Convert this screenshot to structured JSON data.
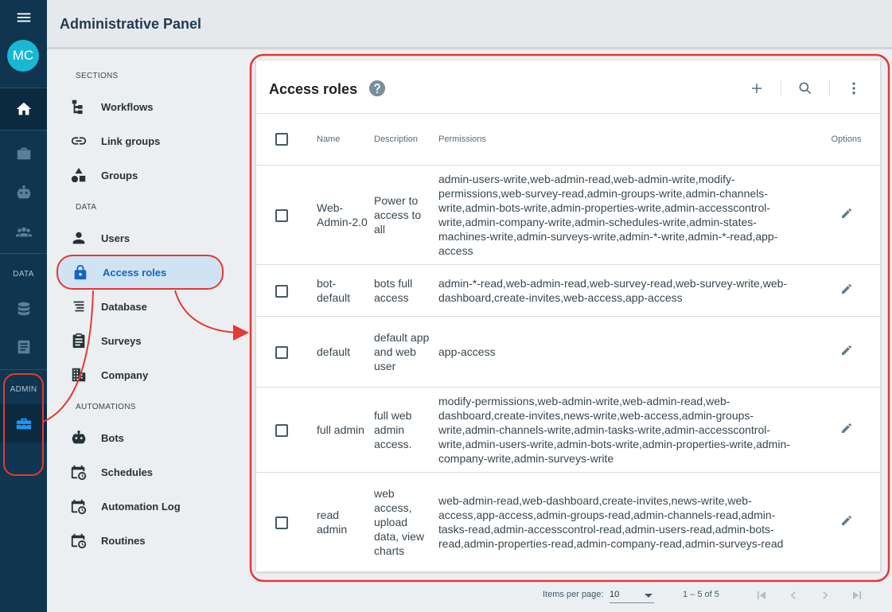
{
  "header": {
    "title": "Administrative Panel"
  },
  "rail": {
    "avatar_initials": "MC",
    "data_label": "DATA",
    "admin_label": "ADMIN",
    "icons": [
      "menu-icon",
      "home-icon",
      "briefcase-icon",
      "robot-icon",
      "people-icon",
      "database-icon",
      "document-icon",
      "toolbox-icon"
    ]
  },
  "nav": {
    "sections_label": "SECTIONS",
    "data_label": "DATA",
    "automations_label": "AUTOMATIONS",
    "items": [
      {
        "label": "Workflows",
        "icon": "sitemap-icon"
      },
      {
        "label": "Link groups",
        "icon": "link-icon"
      },
      {
        "label": "Groups",
        "icon": "shapes-icon"
      },
      {
        "label": "Users",
        "icon": "person-icon"
      },
      {
        "label": "Access roles",
        "icon": "lock-icon",
        "active": true
      },
      {
        "label": "Database",
        "icon": "sort-lines-icon"
      },
      {
        "label": "Surveys",
        "icon": "clipboard-icon"
      },
      {
        "label": "Company",
        "icon": "building-icon"
      },
      {
        "label": "Bots",
        "icon": "robot-icon"
      },
      {
        "label": "Schedules",
        "icon": "calendar-clock-icon"
      },
      {
        "label": "Automation Log",
        "icon": "calendar-clock-icon"
      },
      {
        "label": "Routines",
        "icon": "calendar-clock-icon"
      }
    ]
  },
  "card": {
    "title": "Access roles",
    "columns": {
      "name": "Name",
      "description": "Description",
      "permissions": "Permissions",
      "options": "Options"
    },
    "rows": [
      {
        "name": "Web-Admin-2.0",
        "description": "Power to access to all",
        "permissions": "admin-users-write,web-admin-read,web-admin-write,modify-permissions,web-survey-read,admin-groups-write,admin-channels-write,admin-bots-write,admin-properties-write,admin-accesscontrol-write,admin-company-write,admin-schedules-write,admin-states-machines-write,admin-surveys-write,admin-*-write,admin-*-read,app-access"
      },
      {
        "name": "bot-default",
        "description": "bots full access",
        "permissions": "admin-*-read,web-admin-read,web-survey-read,web-survey-write,web-dashboard,create-invites,web-access,app-access"
      },
      {
        "name": "default",
        "description": "default app and web user",
        "permissions": "app-access"
      },
      {
        "name": "full admin",
        "description": "full web admin access.",
        "permissions": "modify-permissions,web-admin-write,web-admin-read,web-dashboard,create-invites,news-write,web-access,admin-groups-write,admin-channels-write,admin-tasks-write,admin-accesscontrol-write,admin-users-write,admin-bots-write,admin-properties-write,admin-company-write,admin-surveys-write"
      },
      {
        "name": "read admin",
        "description": "web access, upload data, view charts",
        "permissions": "web-admin-read,web-dashboard,create-invites,news-write,web-access,app-access,admin-groups-read,admin-channels-read,admin-tasks-read,admin-accesscontrol-read,admin-users-read,admin-bots-read,admin-properties-read,admin-company-read,admin-surveys-read"
      }
    ]
  },
  "footer": {
    "items_per_page_label": "Items per page:",
    "items_per_page_value": "10",
    "range": "1 – 5 of 5"
  },
  "colors": {
    "rail": "#0f3550",
    "accent": "#1565c0",
    "annotation": "#e53935",
    "avatar": "#18b8d2"
  }
}
